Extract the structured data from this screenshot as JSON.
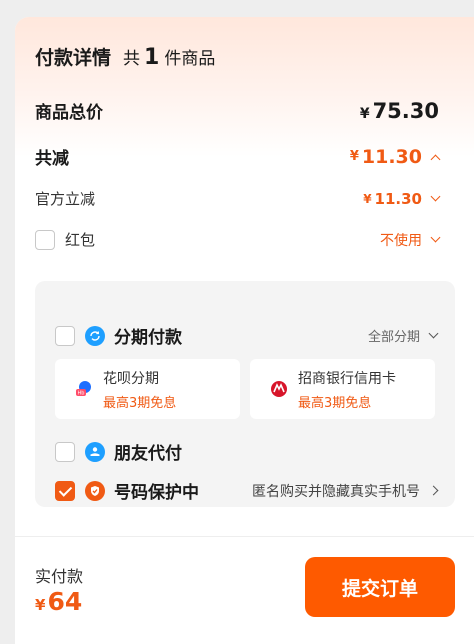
{
  "header": {
    "title": "付款详情",
    "count_prefix": "共",
    "count": "1",
    "count_suffix": "件商品"
  },
  "summary": {
    "subtotal_label": "商品总价",
    "currency": "¥",
    "subtotal_value": "75.30",
    "discount_label": "共减",
    "discount_value": "11.30",
    "official_label": "官方立减",
    "official_value": "11.30",
    "hongbao_label": "红包",
    "hongbao_value": "不使用"
  },
  "payment": {
    "installment": {
      "label": "分期付款",
      "right_text": "全部分期",
      "icon": "installment-icon",
      "checked": false
    },
    "options": [
      {
        "name": "花呗分期",
        "sub": "最高3期免息",
        "icon": "huabei-icon"
      },
      {
        "name": "招商银行信用卡",
        "sub": "最高3期免息",
        "icon": "cmb-bank-icon"
      }
    ],
    "friend_pay": {
      "label": "朋友代付",
      "icon": "friend-pay-icon",
      "checked": false
    },
    "number_protect": {
      "label": "号码保护中",
      "right_text": "匿名购买并隐藏真实手机号",
      "icon": "shield-icon",
      "checked": true
    }
  },
  "footer": {
    "total_label": "实付款",
    "currency": "¥",
    "total_value": "64",
    "submit_label": "提交订单"
  },
  "colors": {
    "accent": "#f05a14",
    "submit": "#fe5a00",
    "installment_icon": "#1e9fff"
  }
}
